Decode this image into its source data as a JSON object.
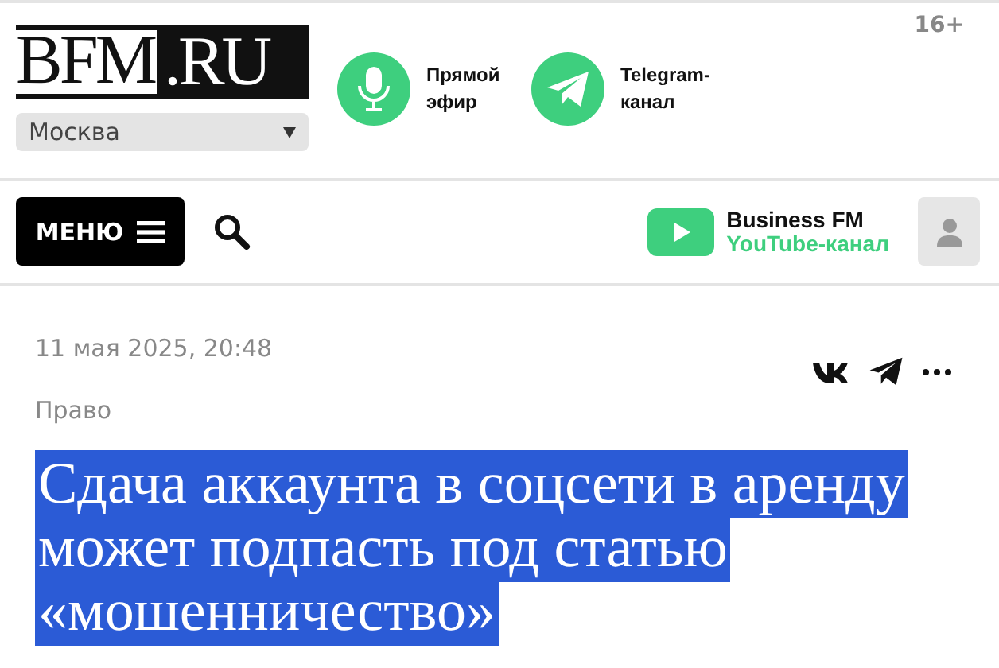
{
  "header": {
    "logo": {
      "left": "BFM",
      "right": ".RU"
    },
    "city": "Москва",
    "links": [
      {
        "kind": "mic",
        "label": "Прямой эфир"
      },
      {
        "kind": "telegram",
        "label": "Telegram-канал"
      }
    ],
    "age_rating": "16+"
  },
  "nav": {
    "menu": "МЕНЮ",
    "youtube": {
      "title": "Business FM",
      "subtitle": "YouTube-канал"
    }
  },
  "article": {
    "date": "11 мая 2025, 20:48",
    "category": "Право",
    "headline": "Сдача аккаунта в соцсети в аренду может подпасть под статью «мошенничество»"
  }
}
